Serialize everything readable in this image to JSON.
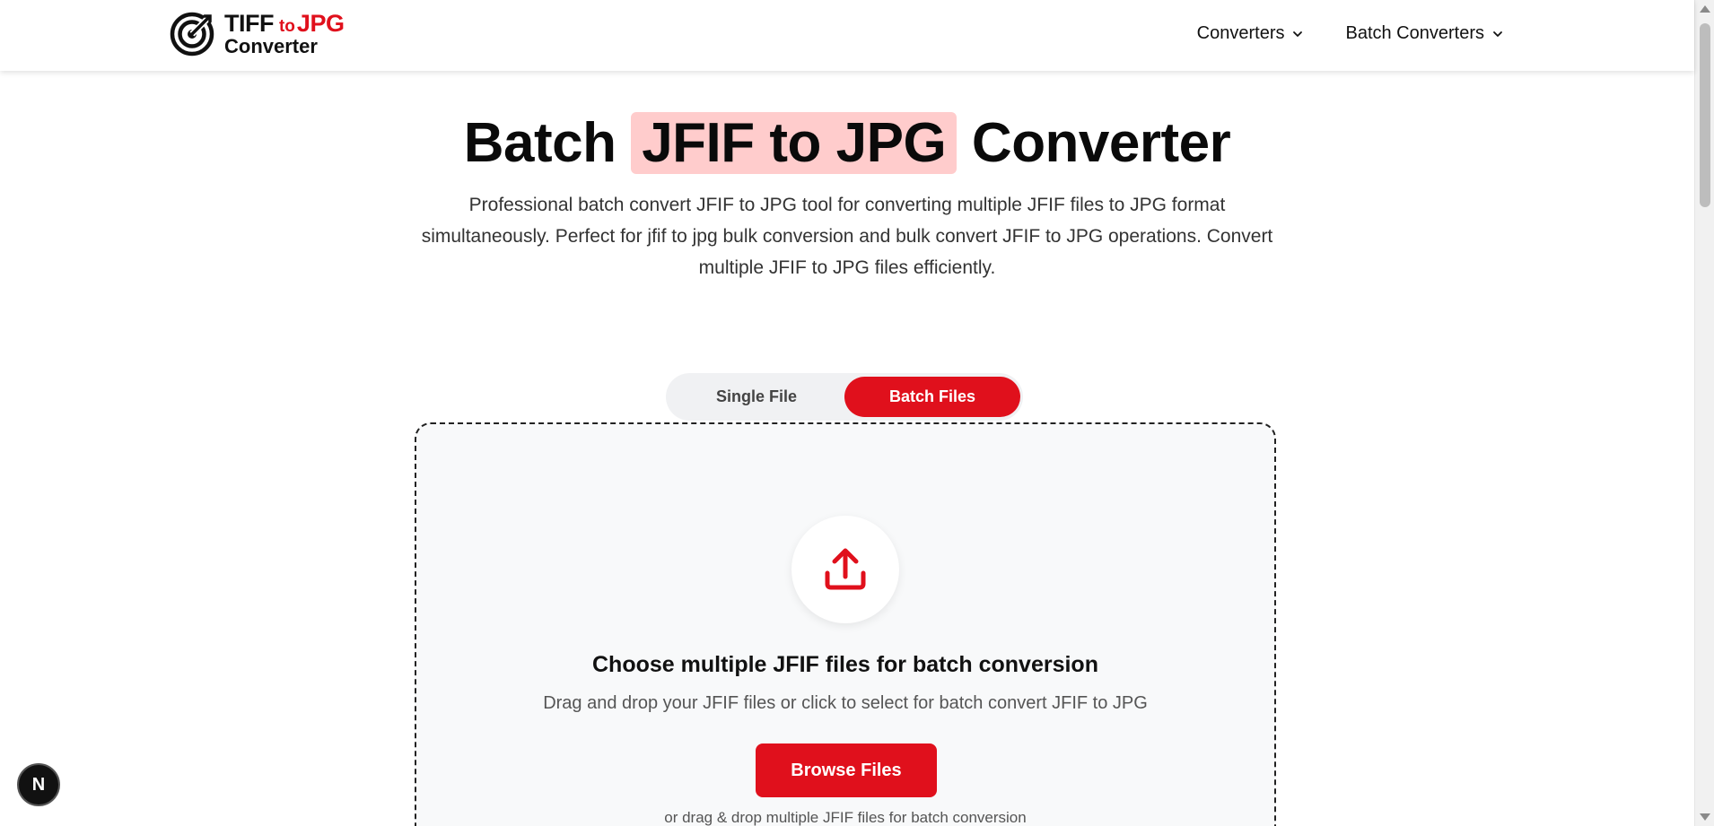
{
  "brand": {
    "logo_word1": "TIFF",
    "logo_to": "to",
    "logo_word2": "JPG",
    "logo_line2": "Converter",
    "accent_color": "#e0101c"
  },
  "nav": {
    "items": [
      {
        "label": "Converters",
        "icon": "chevron-down-icon"
      },
      {
        "label": "Batch Converters",
        "icon": "chevron-down-icon"
      }
    ]
  },
  "hero": {
    "title_before": "Batch ",
    "title_highlight": "JFIF to JPG",
    "title_after": " Converter",
    "description": "Professional batch convert JFIF to JPG tool for converting multiple JFIF files to JPG format simultaneously. Perfect for jfif to jpg bulk conversion and bulk convert JFIF to JPG operations. Convert multiple JFIF to JPG files efficiently."
  },
  "tabs": {
    "single": "Single File",
    "batch": "Batch Files",
    "selected": "Batch Files"
  },
  "dropzone": {
    "icon": "upload-icon",
    "title": "Choose multiple JFIF files for batch conversion",
    "subtitle": "Drag and drop your JFIF files or click to select for batch convert JFIF to JPG",
    "button_label": "Browse Files",
    "hint": "or drag & drop multiple JFIF files for batch conversion"
  },
  "floating_badge": {
    "label": "N"
  }
}
